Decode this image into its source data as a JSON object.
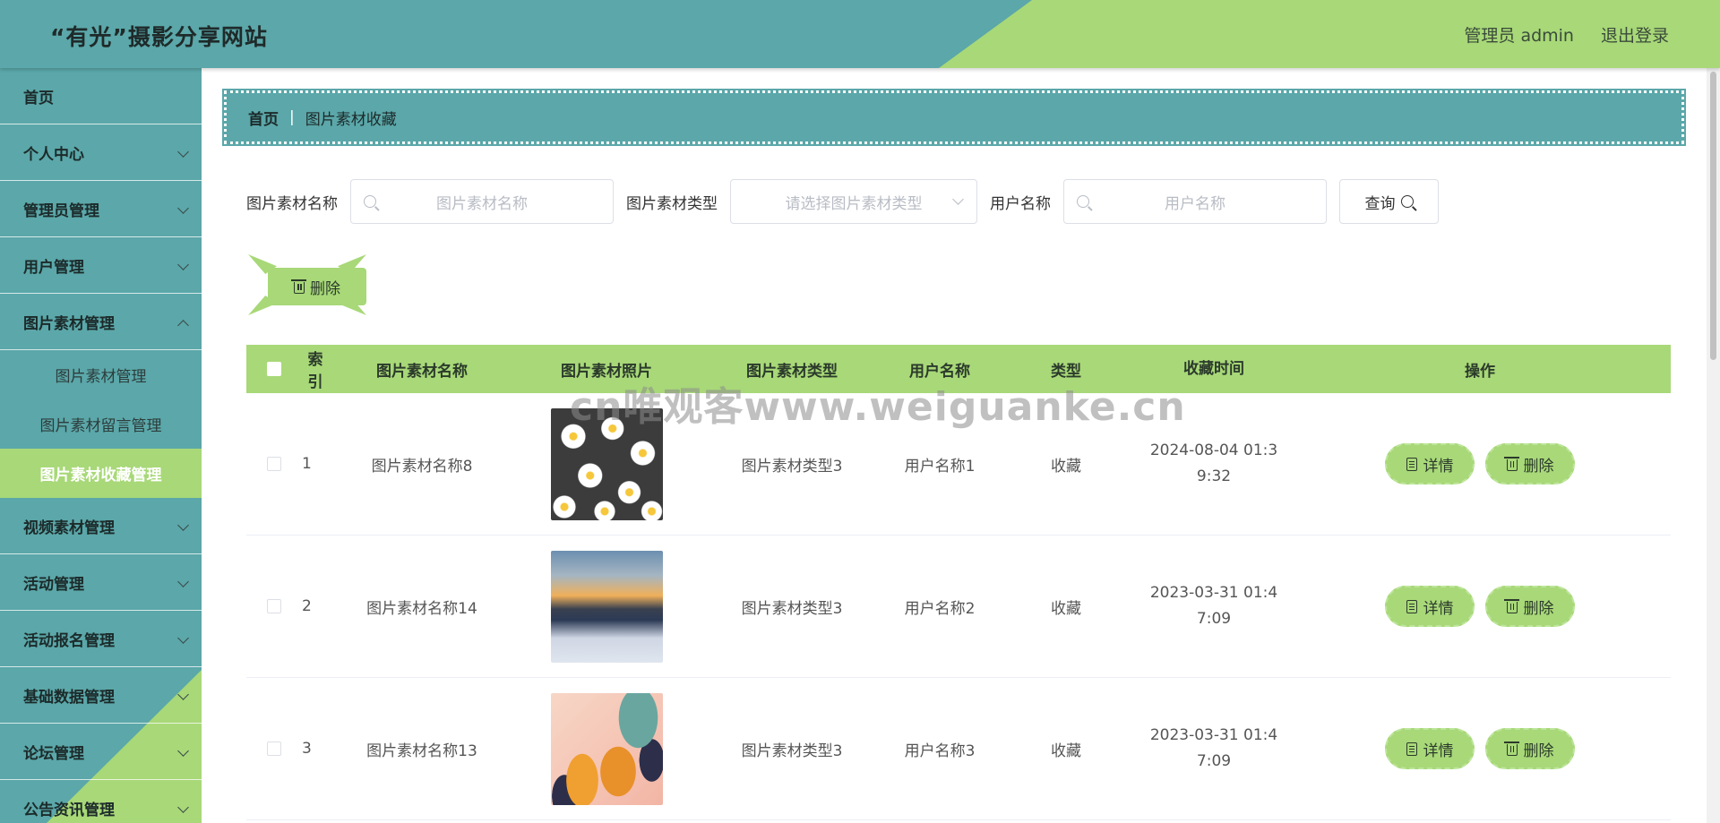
{
  "header": {
    "site_title": "“有光”摄影分享网站",
    "admin_label": "管理员 admin",
    "logout_label": "退出登录"
  },
  "sidebar": {
    "items": [
      {
        "label": "首页"
      },
      {
        "label": "个人中心"
      },
      {
        "label": "管理员管理"
      },
      {
        "label": "用户管理"
      },
      {
        "label": "图片素材管理"
      },
      {
        "label": "视频素材管理"
      },
      {
        "label": "活动管理"
      },
      {
        "label": "活动报名管理"
      },
      {
        "label": "基础数据管理"
      },
      {
        "label": "论坛管理"
      },
      {
        "label": "公告资讯管理"
      }
    ],
    "submenu": [
      {
        "label": "图片素材管理"
      },
      {
        "label": "图片素材留言管理"
      },
      {
        "label": "图片素材收藏管理",
        "active": true
      }
    ]
  },
  "breadcrumb": {
    "home": "首页",
    "separator": "|",
    "current": "图片素材收藏"
  },
  "filters": {
    "name_label": "图片素材名称",
    "name_placeholder": "图片素材名称",
    "type_label": "图片素材类型",
    "type_placeholder": "请选择图片素材类型",
    "user_label": "用户名称",
    "user_placeholder": "用户名称",
    "query_label": "查询"
  },
  "toolbar": {
    "delete_label": "删除"
  },
  "table": {
    "headers": [
      "索引",
      "图片素材名称",
      "图片素材照片",
      "图片素材类型",
      "用户名称",
      "类型",
      "收藏时间",
      "操作"
    ],
    "rows": [
      {
        "index": "1",
        "name": "图片素材名称8",
        "ptype": "图片素材类型3",
        "user": "用户名称1",
        "type": "收藏",
        "time_line1": "2024-08-04 01:3",
        "time_line2": "9:32"
      },
      {
        "index": "2",
        "name": "图片素材名称14",
        "ptype": "图片素材类型3",
        "user": "用户名称2",
        "type": "收藏",
        "time_line1": "2023-03-31 01:4",
        "time_line2": "7:09"
      },
      {
        "index": "3",
        "name": "图片素材名称13",
        "ptype": "图片素材类型3",
        "user": "用户名称3",
        "type": "收藏",
        "time_line1": "2023-03-31 01:4",
        "time_line2": "7:09"
      }
    ],
    "detail_label": "详情",
    "delete_label": "删除"
  },
  "watermark": "cn唯观客www.weiguanke.cn",
  "colors": {
    "teal": "#5ba7a9",
    "green": "#a8d878"
  }
}
